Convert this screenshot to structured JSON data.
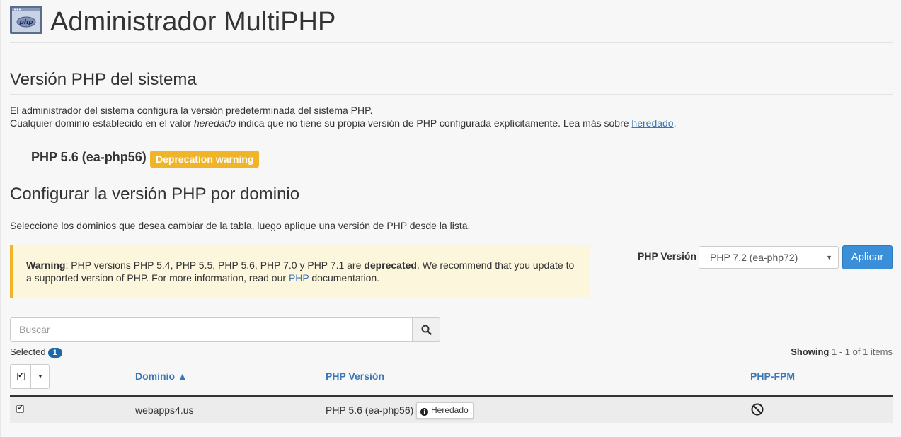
{
  "page": {
    "title": "Administrador MultiPHP",
    "app_icon": "php-icon",
    "app_icon_text": "php"
  },
  "system_section": {
    "heading": "Versión PHP del sistema",
    "line1": "El administrador del sistema configura la versión predeterminada del sistema PHP.",
    "line2_pre": "Cualquier dominio establecido en el valor ",
    "line2_em": "heredado",
    "line2_post": " indica que no tiene su propia versión de PHP configurada explícitamente. Lea más sobre ",
    "line2_link": "heredado",
    "line2_end": ".",
    "current_version": "PHP 5.6 (ea-php56)",
    "badge": "Deprecation warning",
    "badge_color": "#f0b429"
  },
  "domain_section": {
    "heading": "Configurar la versión PHP por dominio",
    "instructions": "Seleccione los dominios que desea cambiar de la tabla, luego aplique una versión de PHP desde la lista."
  },
  "warning": {
    "label": "Warning",
    "text_a": ": PHP versions PHP 5.4, PHP 5.5, PHP 5.6, PHP 7.0 y PHP 7.1 are ",
    "bold": "deprecated",
    "text_b": ". We recommend that you update to a supported version of PHP. For more information, read our ",
    "link": "PHP",
    "text_c": " documentation."
  },
  "version_picker": {
    "label": "PHP Versión",
    "selected": "PHP 7.2 (ea-php72)",
    "apply_label": "Aplicar",
    "accent": "#3b8ed8"
  },
  "search": {
    "placeholder": "Buscar",
    "icon": "search-icon"
  },
  "selection": {
    "label": "Selected",
    "count": "1"
  },
  "paging": {
    "showing_label": "Showing",
    "range": "1 - 1 of 1 items"
  },
  "table": {
    "columns": {
      "domain": "Dominio ▲",
      "php_version": "PHP Versión",
      "php_fpm": "PHP-FPM"
    },
    "rows": [
      {
        "checked": true,
        "domain": "webapps4.us",
        "php_version": "PHP 5.6 (ea-php56)",
        "tag": "Heredado",
        "fpm_icon": "disabled-circle-icon"
      }
    ]
  }
}
